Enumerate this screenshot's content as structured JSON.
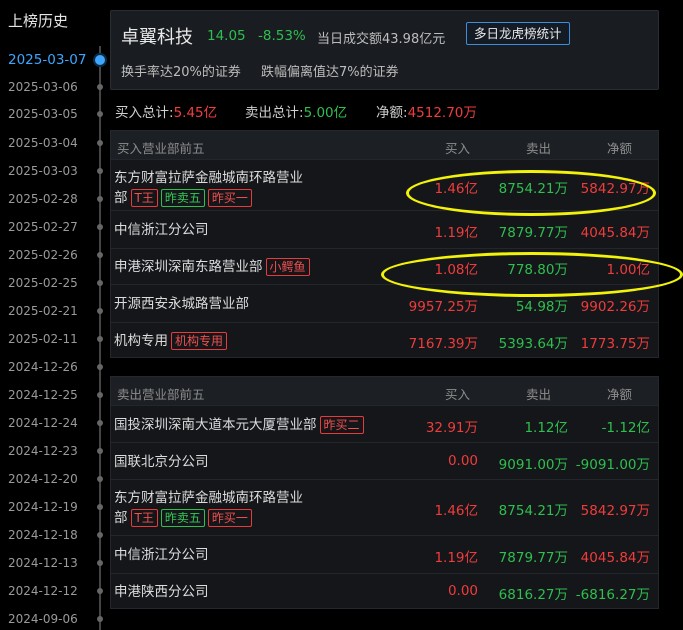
{
  "timeline": {
    "title": "上榜历史",
    "dates": [
      "2025-03-07",
      "2025-03-06",
      "2025-03-05",
      "2025-03-04",
      "2025-03-03",
      "2025-02-28",
      "2025-02-27",
      "2025-02-26",
      "2025-02-25",
      "2025-02-21",
      "2025-02-11",
      "2024-12-26",
      "2024-12-25",
      "2024-12-24",
      "2024-12-23",
      "2024-12-20",
      "2024-12-19",
      "2024-12-18",
      "2024-12-13",
      "2024-12-12",
      "2024-09-06"
    ],
    "active_index": 0
  },
  "stock": {
    "name": "卓翼科技",
    "price": "14.05",
    "change_pct": "-8.53%",
    "turnover": "当日成交额43.98亿元",
    "multi_day_button": "多日龙虎榜统计",
    "reason_1": "换手率达20%的证券",
    "reason_2": "跌幅偏离值达7%的证券"
  },
  "totals": {
    "buy_label": "买入总计:",
    "buy_value": "5.45亿",
    "sell_label": "卖出总计:",
    "sell_value": "5.00亿",
    "net_label": "净额:",
    "net_value": "4512.70万"
  },
  "buy_table": {
    "headers": {
      "name": "买入营业部前五",
      "buy": "买入",
      "sell": "卖出",
      "net": "净额"
    },
    "rows": [
      {
        "name_line1": "东方财富拉萨金融城南环路营业",
        "name_line2": "部",
        "tags": [
          "T王",
          "昨卖五",
          "昨买一"
        ],
        "buy": "1.46亿",
        "sell": "8754.21万",
        "net": "5842.97万"
      },
      {
        "name_line1": "中信浙江分公司",
        "tags": [],
        "buy": "1.19亿",
        "sell": "7879.77万",
        "net": "4045.84万"
      },
      {
        "name_line1": "申港深圳深南东路营业部",
        "tags": [
          "小鳄鱼"
        ],
        "buy": "1.08亿",
        "sell": "778.80万",
        "net": "1.00亿"
      },
      {
        "name_line1": "开源西安永城路营业部",
        "tags": [],
        "buy": "9957.25万",
        "sell": "54.98万",
        "net": "9902.26万"
      },
      {
        "name_line1": "机构专用",
        "tags": [
          "机构专用"
        ],
        "buy": "7167.39万",
        "sell": "5393.64万",
        "net": "1773.75万"
      }
    ]
  },
  "sell_table": {
    "headers": {
      "name": "卖出营业部前五",
      "buy": "买入",
      "sell": "卖出",
      "net": "净额"
    },
    "rows": [
      {
        "name_line1": "国投深圳深南大道本元大厦营业部",
        "tags": [
          "昨买二"
        ],
        "buy": "32.91万",
        "sell": "1.12亿",
        "net": "-1.12亿"
      },
      {
        "name_line1": "国联北京分公司",
        "tags": [],
        "buy": "0.00",
        "sell": "9091.00万",
        "net": "-9091.00万"
      },
      {
        "name_line1": "东方财富拉萨金融城南环路营业",
        "name_line2": "部",
        "tags": [
          "T王",
          "昨卖五",
          "昨买一"
        ],
        "buy": "1.46亿",
        "sell": "8754.21万",
        "net": "5842.97万"
      },
      {
        "name_line1": "中信浙江分公司",
        "tags": [],
        "buy": "1.19亿",
        "sell": "7879.77万",
        "net": "4045.84万"
      },
      {
        "name_line1": "申港陕西分公司",
        "tags": [],
        "buy": "0.00",
        "sell": "6816.27万",
        "net": "-6816.27万"
      }
    ]
  },
  "colors": {
    "up": "#f03c3c",
    "down": "#2ebf4f",
    "accent": "#3ea6ff",
    "highlight": "#f2f20a"
  }
}
